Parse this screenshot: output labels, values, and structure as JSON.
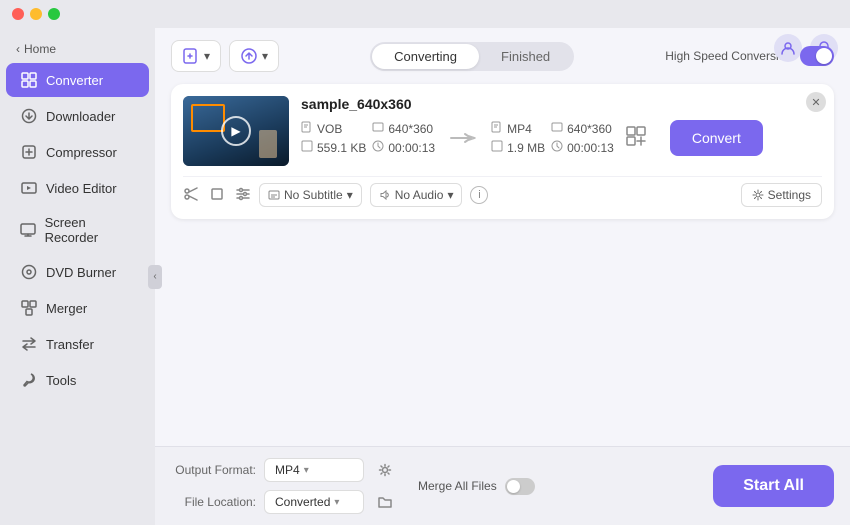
{
  "titlebar": {
    "dots": [
      "red",
      "yellow",
      "green"
    ]
  },
  "sidebar": {
    "home_label": "Home",
    "items": [
      {
        "id": "converter",
        "label": "Converter",
        "icon": "⧉",
        "active": true
      },
      {
        "id": "downloader",
        "label": "Downloader",
        "icon": "⬇"
      },
      {
        "id": "compressor",
        "label": "Compressor",
        "icon": "⊡"
      },
      {
        "id": "video-editor",
        "label": "Video Editor",
        "icon": "✂"
      },
      {
        "id": "screen-recorder",
        "label": "Screen Recorder",
        "icon": "⬚"
      },
      {
        "id": "dvd-burner",
        "label": "DVD Burner",
        "icon": "⊙"
      },
      {
        "id": "merger",
        "label": "Merger",
        "icon": "⊞"
      },
      {
        "id": "transfer",
        "label": "Transfer",
        "icon": "↔"
      },
      {
        "id": "tools",
        "label": "Tools",
        "icon": "⚒"
      }
    ]
  },
  "header_icons": {
    "user_icon": "👤",
    "bell_icon": "🔔"
  },
  "toolbar": {
    "add_file_label": "+",
    "add_options_label": "▾",
    "convert_options_label": "▾",
    "tabs": [
      {
        "id": "converting",
        "label": "Converting",
        "active": true
      },
      {
        "id": "finished",
        "label": "Finished",
        "active": false
      }
    ],
    "high_speed_label": "High Speed Conversion"
  },
  "file_card": {
    "file_name": "sample_640x360",
    "source": {
      "format": "VOB",
      "resolution": "640*360",
      "size": "559.1 KB",
      "duration": "00:00:13"
    },
    "target": {
      "format": "MP4",
      "resolution": "640*360",
      "size": "1.9 MB",
      "duration": "00:00:13"
    },
    "subtitle": "No Subtitle",
    "audio": "No Audio",
    "settings_label": "Settings",
    "convert_label": "Convert"
  },
  "bottom_bar": {
    "output_format_label": "Output Format:",
    "output_format_value": "MP4",
    "file_location_label": "File Location:",
    "file_location_value": "Converted",
    "merge_all_label": "Merge All Files",
    "start_all_label": "Start All"
  }
}
